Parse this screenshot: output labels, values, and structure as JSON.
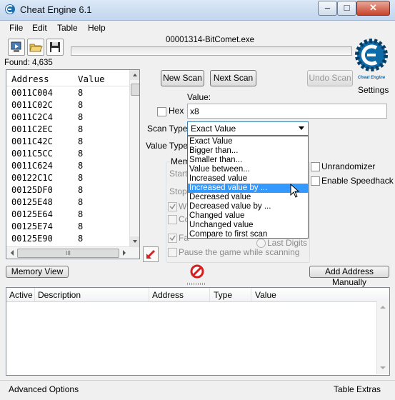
{
  "window": {
    "title": "Cheat Engine 6.1",
    "min": "–",
    "max": "□",
    "close": "✕"
  },
  "menu": [
    "File",
    "Edit",
    "Table",
    "Help"
  ],
  "toolbar": {
    "process_name": "00001314-BitComet.exe",
    "settings_label": "Settings",
    "logo_caption": "Cheat Engine"
  },
  "found_label": "Found: 4,635",
  "results": {
    "col_address": "Address",
    "col_value": "Value",
    "rows": [
      {
        "address": "0011C004",
        "value": "8"
      },
      {
        "address": "0011C02C",
        "value": "8"
      },
      {
        "address": "0011C2C4",
        "value": "8"
      },
      {
        "address": "0011C2EC",
        "value": "8"
      },
      {
        "address": "0011C42C",
        "value": "8"
      },
      {
        "address": "0011C5CC",
        "value": "8"
      },
      {
        "address": "0011C624",
        "value": "8"
      },
      {
        "address": "00122C1C",
        "value": "8"
      },
      {
        "address": "00125DF0",
        "value": "8"
      },
      {
        "address": "00125E48",
        "value": "8"
      },
      {
        "address": "00125E64",
        "value": "8"
      },
      {
        "address": "00125E74",
        "value": "8"
      },
      {
        "address": "00125E90",
        "value": "8"
      }
    ],
    "hscroll_grip": "III"
  },
  "scan": {
    "new_scan": "New Scan",
    "next_scan": "Next Scan",
    "undo_scan": "Undo Scan",
    "value_label": "Value:",
    "hex_label": "Hex",
    "value_input": "x8",
    "scan_type_label": "Scan Type",
    "scan_type_selected": "Exact Value",
    "value_type_label": "Value Type",
    "memory_group_label": "Mem",
    "start_label": "Start",
    "stop_label": "Stop",
    "writable_label": "W",
    "copy_on_write_label": "Co",
    "fast_scan_label": "Fa",
    "last_digits_label": "Last Digits",
    "pause_label": "Pause the game while scanning",
    "unrandomizer_label": "Unrandomizer",
    "speedhack_label": "Enable Speedhack",
    "dropdown_options": [
      "Exact Value",
      "Bigger than...",
      "Smaller than...",
      "Value between...",
      "Increased value",
      "Increased value by ...",
      "Decreased value",
      "Decreased value by ...",
      "Changed value",
      "Unchanged value",
      "Compare to first scan"
    ],
    "highlighted_option_index": 5
  },
  "memory_view": "Memory View",
  "add_address_manually": "Add Address Manually",
  "cheat_table": {
    "columns": [
      "Active",
      "Description",
      "Address",
      "Type",
      "Value"
    ]
  },
  "status": {
    "advanced": "Advanced Options",
    "extras": "Table Extras"
  },
  "colors": {
    "accent": "#3399ff",
    "logo": "#0f6aa8",
    "stop_red": "#d42020"
  }
}
